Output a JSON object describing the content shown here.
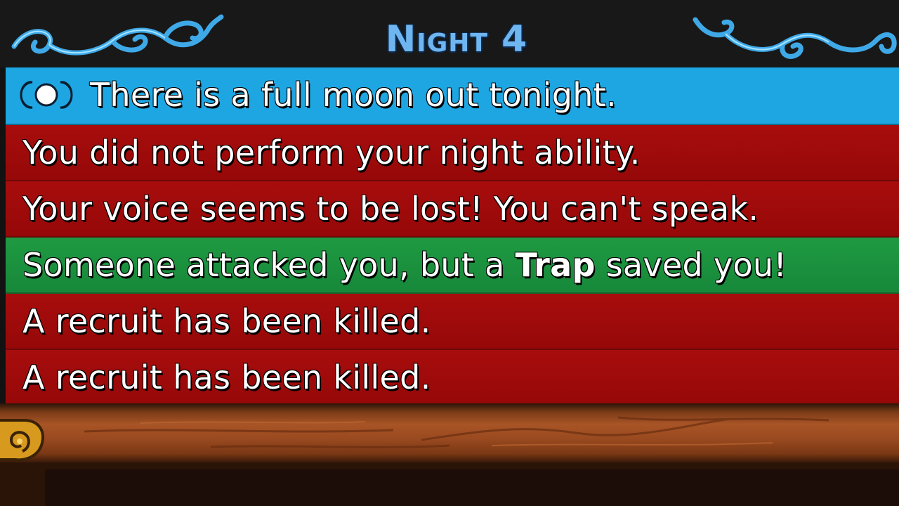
{
  "header": {
    "title": "Night 4"
  },
  "messages": [
    {
      "text": "There is a full moon out tonight.",
      "style": "blue",
      "icon": "full-moon-icon"
    },
    {
      "text": "You did not perform your night ability.",
      "style": "red"
    },
    {
      "text": "Your voice seems to be lost! You can't speak.",
      "style": "red"
    },
    {
      "text_before": "Someone attacked you, but a ",
      "text_bold": "Trap",
      "text_after": " saved you!",
      "style": "green"
    },
    {
      "text": "A recruit has been killed.",
      "style": "red"
    },
    {
      "text": "A recruit has been killed.",
      "style": "red"
    }
  ],
  "colors": {
    "title": "#6fb6f0",
    "moon_row": "#1ea6e2",
    "negative_row": "#a80d0d",
    "positive_row": "#1f9a42",
    "wood": "#a85426"
  }
}
